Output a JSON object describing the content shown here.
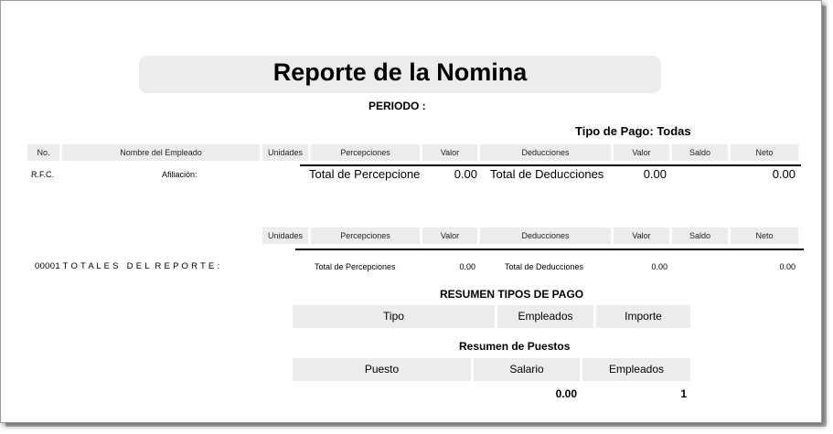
{
  "report": {
    "title": "Reporte de la Nomina",
    "periodo_label": "PERIODO :",
    "tipo_pago_label": "Tipo de Pago: Todas"
  },
  "detail_header": [
    "No.",
    "Nombre del Empleado",
    "Unidades",
    "Percepciones",
    "Valor",
    "Deducciones",
    "Valor",
    "Saldo",
    "Neto"
  ],
  "detail_row": {
    "rfc_label": "R.F.C.",
    "afiliacion_label": "Afiliación:",
    "total_percepcion_label": "Total de Percepcione",
    "total_percepcion_value": "0.00",
    "total_deducciones_label": "Total de Deducciones",
    "total_deducciones_value": "0.00",
    "neto_value": "0.00"
  },
  "totals_header": [
    "Unidades",
    "Percepciones",
    "Valor",
    "Deducciones",
    "Valor",
    "Saldo",
    "Neto"
  ],
  "totals_row": {
    "label": "00001 T O T A L E S   D E L  R E P O R T E :",
    "total_percepciones_label": "Total de Percepciones",
    "total_percepciones_value": "0.00",
    "total_deducciones_label": "Total de Deducciones",
    "total_deducciones_value": "0.00",
    "neto_value": "0.00"
  },
  "resumen_tipos": {
    "title": "RESUMEN TIPOS DE PAGO",
    "columns": [
      "Tipo",
      "Empleados",
      "Importe"
    ]
  },
  "resumen_puestos": {
    "title": "Resumen de Puestos",
    "columns": [
      "Puesto",
      "Salario",
      "Empleados"
    ],
    "row": {
      "salario": "0.00",
      "empleados": "1"
    }
  }
}
